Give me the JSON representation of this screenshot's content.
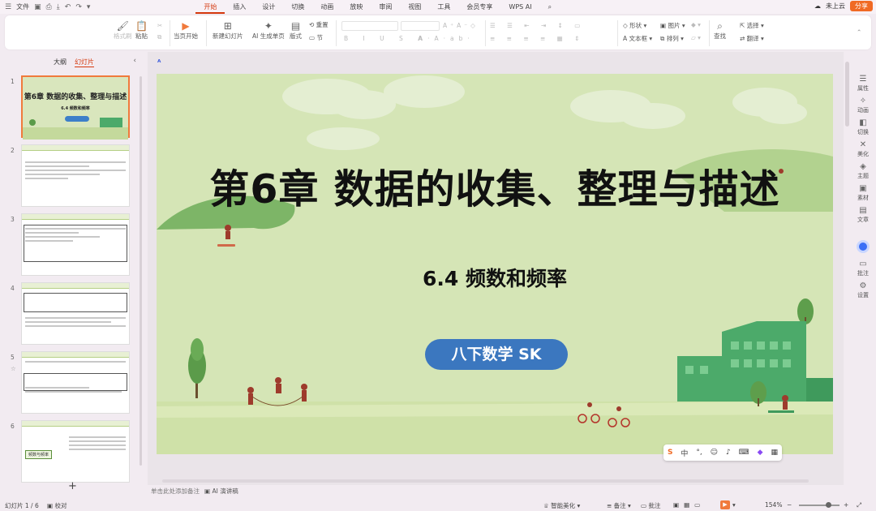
{
  "topbar": {
    "file_label": "文件",
    "menu_items": [
      "开始",
      "插入",
      "设计",
      "切换",
      "动画",
      "放映",
      "审阅",
      "视图",
      "工具",
      "会员专享",
      "WPS AI"
    ],
    "cloud_label": "未上云",
    "share_label": "分享"
  },
  "ribbon": {
    "format_painter": "格式刷",
    "paste": "粘贴",
    "start_from_current": "当页开始",
    "new_slide": "新建幻灯片",
    "ai_generate": "AI 生成单页",
    "layout": "版式",
    "reset": "重置",
    "section": "节",
    "shape": "形状",
    "image": "图片",
    "textbox": "文本框",
    "arrange": "排列",
    "find": "查找",
    "select": "选择",
    "replace": "翻译"
  },
  "panel": {
    "tab_outline": "大纲",
    "tab_slides": "幻灯片",
    "slides": [
      {
        "num": "1",
        "title": "第6章  数据的收集、整理与描述",
        "sub": "6.4 频数和频率"
      },
      {
        "num": "2"
      },
      {
        "num": "3"
      },
      {
        "num": "4"
      },
      {
        "num": "5"
      },
      {
        "num": "6",
        "mindmap_label": "频数与频率"
      }
    ]
  },
  "slide": {
    "title": "第6章  数据的收集、整理与描述",
    "subtitle": "6.4  频数和频率",
    "pill": "八下数学  SK"
  },
  "notes": {
    "placeholder": "单击此处添加备注",
    "ai_speech": "AI 演讲稿"
  },
  "right_panel": [
    "属性",
    "动画",
    "切换",
    "美化",
    "主题",
    "素材",
    "文章",
    "",
    "批注",
    "设置"
  ],
  "status": {
    "slide_count": "幻灯片 1 / 6",
    "proofread": "校对",
    "smart_beautify": "智能美化",
    "notes": "备注",
    "comments": "批注",
    "zoom": "154%"
  },
  "colors": {
    "accent": "#d4380d",
    "slide_bg": "#d5e5b6",
    "pill": "#3b77bf",
    "building": "#4caa6a"
  }
}
